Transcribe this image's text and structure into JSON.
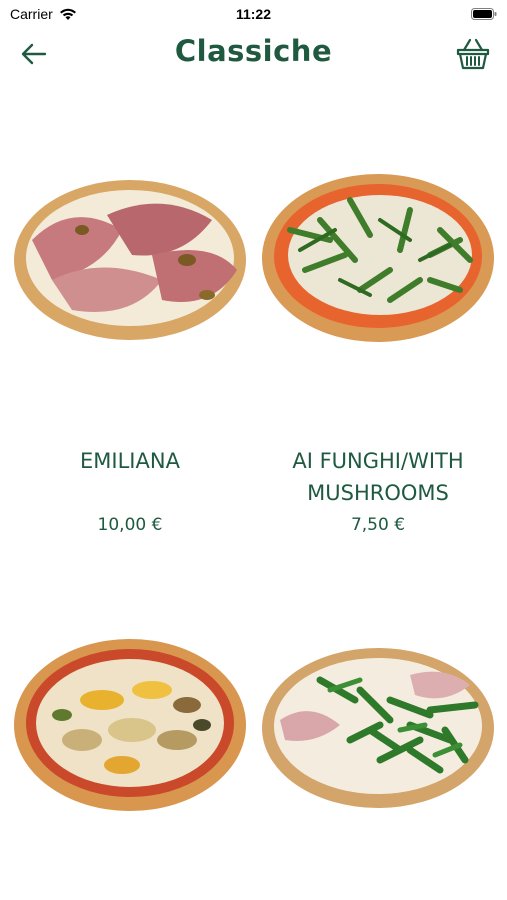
{
  "status_bar": {
    "carrier": "Carrier",
    "time": "11:22"
  },
  "header": {
    "title": "Classiche",
    "back_icon": "arrow-left-icon",
    "cart_icon": "basket-icon"
  },
  "products": [
    {
      "name": "EMILIANA",
      "price": "10,00 €"
    },
    {
      "name": "AI FUNGHI/WITH MUSHROOMS",
      "price": "7,50 €"
    },
    {
      "name": "",
      "price": ""
    },
    {
      "name": "",
      "price": ""
    }
  ],
  "colors": {
    "accent": "#1f5a40",
    "background": "#ffffff"
  }
}
